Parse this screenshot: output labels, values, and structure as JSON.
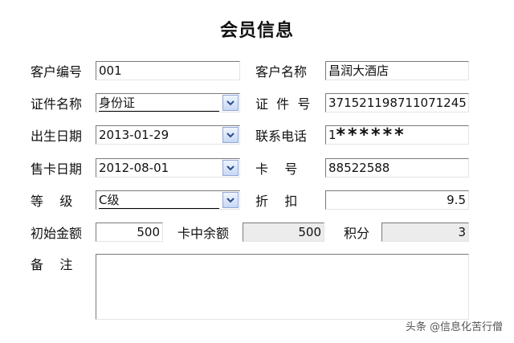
{
  "title": "会员信息",
  "fields": {
    "customer_no": {
      "label": "客户编号",
      "value": "001"
    },
    "customer_name": {
      "label": "客户名称",
      "value": "昌润大酒店"
    },
    "id_type": {
      "label": "证件名称",
      "value": "身份证"
    },
    "id_no": {
      "label": "证  件  号",
      "value": "371521198711071245"
    },
    "birth_date": {
      "label": "出生日期",
      "value": "2013-01-29"
    },
    "phone": {
      "label": "联系电话",
      "value_prefix": "1",
      "value_masked": "******"
    },
    "issue_date": {
      "label": "售卡日期",
      "value": "2012-08-01"
    },
    "card_no": {
      "label": "卡    号",
      "value": "88522588"
    },
    "level": {
      "label": "等    级",
      "value": "C级"
    },
    "discount": {
      "label": "折    扣",
      "value": "9.5"
    },
    "initial_amount": {
      "label": "初始金额",
      "value": "500"
    },
    "card_balance": {
      "label": "卡中余额",
      "value": "500"
    },
    "points": {
      "label": "积分",
      "value": "3"
    },
    "remark": {
      "label": "备    注",
      "value": ""
    }
  },
  "icons": {
    "dropdown": "chevron-down-icon"
  },
  "watermark": "头条 @信息化苦行僧"
}
